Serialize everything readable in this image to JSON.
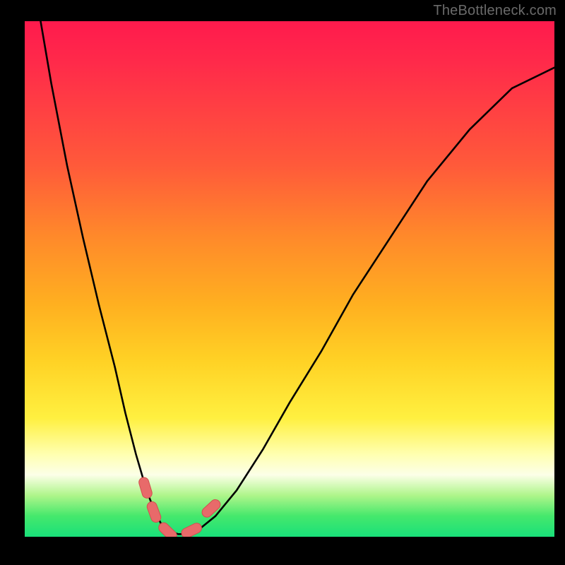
{
  "watermark": {
    "text": "TheBottleneck.com"
  },
  "chart_data": {
    "type": "line",
    "title": "",
    "xlabel": "",
    "ylabel": "",
    "xlim": [
      0,
      100
    ],
    "ylim": [
      0,
      100
    ],
    "grid": false,
    "legend": false,
    "series": [
      {
        "name": "bottleneck-curve",
        "x": [
          3,
          5,
          8,
          11,
          14,
          17,
          19,
          21,
          23,
          24.5,
          26,
          27.5,
          29,
          31,
          33,
          36,
          40,
          45,
          50,
          56,
          62,
          69,
          76,
          84,
          92,
          100
        ],
        "y": [
          100,
          88,
          72,
          58,
          45,
          33,
          24,
          16,
          9,
          5,
          2,
          1,
          0.5,
          0.5,
          1.5,
          4,
          9,
          17,
          26,
          36,
          47,
          58,
          69,
          79,
          87,
          91
        ]
      }
    ],
    "markers": [
      {
        "name": "marker-left-upper",
        "x": 22.8,
        "y": 9.5
      },
      {
        "name": "marker-left-lower",
        "x": 24.4,
        "y": 4.8
      },
      {
        "name": "marker-bottom-left",
        "x": 27.0,
        "y": 1.0
      },
      {
        "name": "marker-bottom-right",
        "x": 31.5,
        "y": 1.2
      },
      {
        "name": "marker-right-upper",
        "x": 35.2,
        "y": 5.5
      }
    ],
    "colors": {
      "curve": "#000000",
      "marker_fill": "#e86a6a",
      "marker_stroke": "#d24f4f"
    }
  }
}
